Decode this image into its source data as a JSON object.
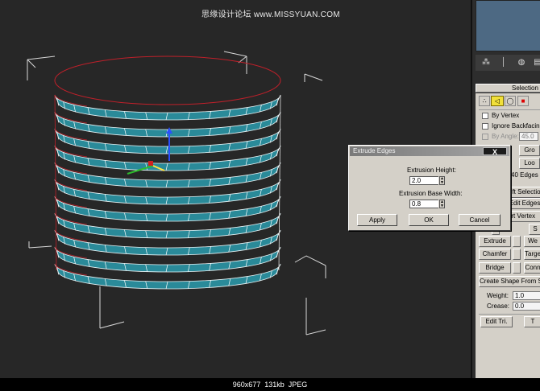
{
  "watermark": "思缘设计论坛 www.MISSYUAN.COM",
  "colors": {
    "mesh": "#2a8a99",
    "viewport_bg": "#272727",
    "panel_bg": "#d4d0c8",
    "selection_red": "#c0202a"
  },
  "command_panel": {
    "tab_icons": [
      "create-icon",
      "modify-icon",
      "hierarchy-icon",
      "motion-icon"
    ],
    "selection_title": "Selection",
    "by_vertex_label": "By Vertex",
    "ignore_backfacing_label": "Ignore Backfacing",
    "by_angle_label": "By Angle:",
    "by_angle_value": "45.0",
    "grow_label": "Gro",
    "loop_label": "Loo",
    "selected_info": "40 Edges S",
    "soft_selection_label": "oft Selection",
    "edit_edges_label": "Edit Edges",
    "insert_vertex_label": "sert Vertex",
    "remove_label": "o",
    "split_label": "S",
    "extrude_label": "Extrude",
    "weld_label": "We",
    "chamfer_label": "Chamfer",
    "target_weld_label": "Targe",
    "bridge_label": "Bridge",
    "connect_label": "Conn",
    "create_shape_label": "Create Shape From Se",
    "weight_label": "Weight:",
    "weight_value": "1.0",
    "crease_label": "Crease:",
    "crease_value": "0.0",
    "edit_tri_label": "Edit Tri.",
    "turn_label": "T"
  },
  "dialog": {
    "title": "Extrude Edges",
    "close_label": "X",
    "height_label": "Extrusion Height:",
    "height_value": "2.0",
    "base_width_label": "Extrusion Base Width:",
    "base_width_value": "0.8",
    "apply_label": "Apply",
    "ok_label": "OK",
    "cancel_label": "Cancel"
  },
  "status_bar": "960x677  131kb  JPEG"
}
